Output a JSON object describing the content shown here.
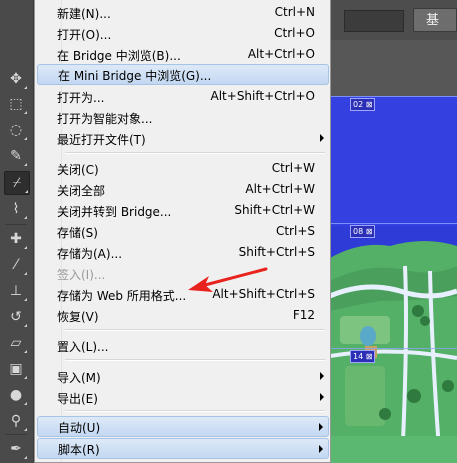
{
  "menu": {
    "items": [
      {
        "label": "新建(N)...",
        "shortcut": "Ctrl+N"
      },
      {
        "label": "打开(O)...",
        "shortcut": "Ctrl+O"
      },
      {
        "label": "在 Bridge 中浏览(B)...",
        "shortcut": "Alt+Ctrl+O"
      },
      {
        "label": "在 Mini Bridge 中浏览(G)...",
        "shortcut": ""
      },
      {
        "label": "打开为...",
        "shortcut": "Alt+Shift+Ctrl+O"
      },
      {
        "label": "打开为智能对象...",
        "shortcut": ""
      },
      {
        "label": "最近打开文件(T)",
        "shortcut": ""
      },
      {
        "label": "关闭(C)",
        "shortcut": "Ctrl+W"
      },
      {
        "label": "关闭全部",
        "shortcut": "Alt+Ctrl+W"
      },
      {
        "label": "关闭并转到 Bridge...",
        "shortcut": "Shift+Ctrl+W"
      },
      {
        "label": "存储(S)",
        "shortcut": "Ctrl+S"
      },
      {
        "label": "存储为(A)...",
        "shortcut": "Shift+Ctrl+S"
      },
      {
        "label": "签入(I)...",
        "shortcut": ""
      },
      {
        "label": "存储为 Web 所用格式...",
        "shortcut": "Alt+Shift+Ctrl+S"
      },
      {
        "label": "恢复(V)",
        "shortcut": "F12"
      },
      {
        "label": "置入(L)...",
        "shortcut": ""
      },
      {
        "label": "导入(M)",
        "shortcut": ""
      },
      {
        "label": "导出(E)",
        "shortcut": ""
      },
      {
        "label": "自动(U)",
        "shortcut": ""
      },
      {
        "label": "脚本(R)",
        "shortcut": ""
      }
    ]
  },
  "optbar": {
    "workspace_label": "基"
  },
  "canvas": {
    "slices": [
      {
        "label": "02 ⊠"
      },
      {
        "label": "08 ⊠"
      },
      {
        "label": "14 ⊠"
      }
    ],
    "colors": {
      "sky": "#2f3bd6",
      "land": "#4aa75a",
      "water": "#e8f0ff",
      "highlight": "#c3d8f2"
    }
  }
}
